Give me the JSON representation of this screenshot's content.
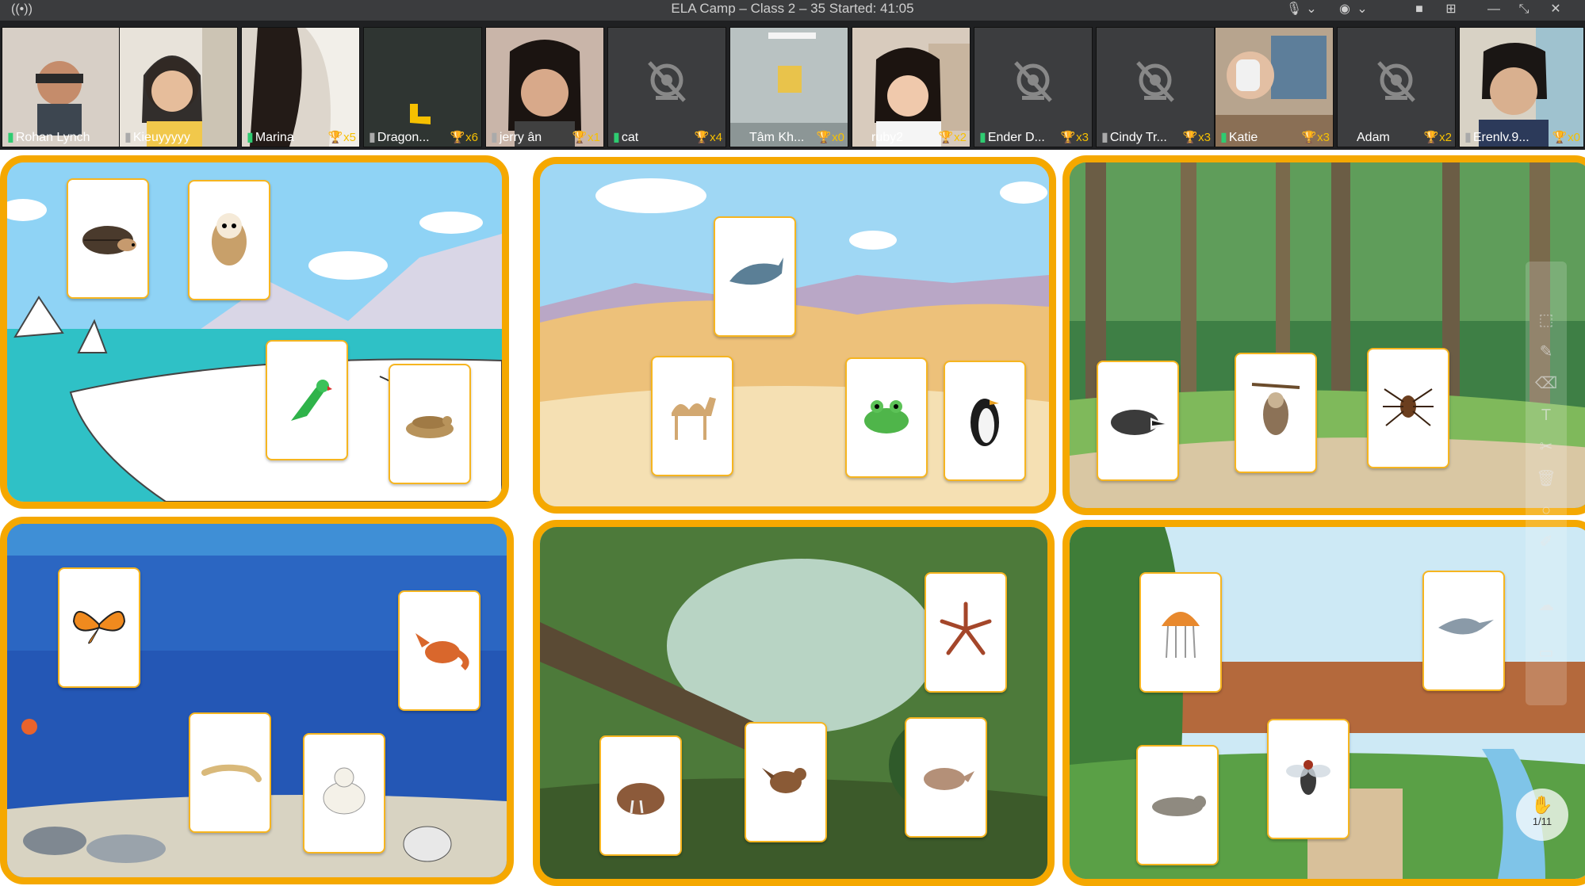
{
  "window": {
    "title": "ELA Camp – Class 2 – 35    Started: 41:05"
  },
  "participants": [
    {
      "name": "Rohan Lynch",
      "trophies": ""
    },
    {
      "name": "Kieuyyyyy",
      "trophies": ""
    },
    {
      "name": "Marina",
      "trophies": "x5"
    },
    {
      "name": "Dragon...",
      "trophies": "x6"
    },
    {
      "name": "jerry ân",
      "trophies": "x1"
    },
    {
      "name": "cat",
      "trophies": "x4"
    },
    {
      "name": "Tâm Kh...",
      "trophies": "x0"
    },
    {
      "name": "ruby2",
      "trophies": "x2"
    },
    {
      "name": "Ender D...",
      "trophies": "x3"
    },
    {
      "name": "Cindy Tr...",
      "trophies": "x3"
    },
    {
      "name": "Katie",
      "trophies": "x3"
    },
    {
      "name": "Adam",
      "trophies": "x2"
    },
    {
      "name": "Erenlv.9...",
      "trophies": "x0"
    }
  ],
  "colors": {
    "board_border": "#f5a800",
    "card_border": "#f6b520",
    "trophy": "#f6c000"
  },
  "pager": {
    "label": "1/11"
  }
}
